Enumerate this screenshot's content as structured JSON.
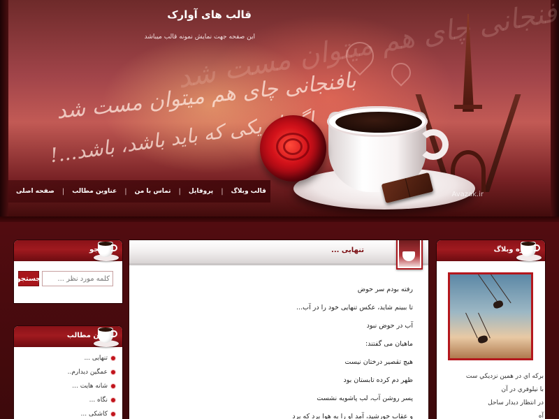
{
  "header": {
    "title": "قالب های آوارک",
    "subtitle": "این صفحه جهت نمایش نمونه قالب میباشد",
    "calligraphy_line_1": "بافنجانی چای هم میتوان مست شد",
    "calligraphy_line_2": "اگر او یکی که باید باشد، باشد...!",
    "watermark": "Avazak.ir"
  },
  "nav": {
    "items": [
      "صفحه اصلی",
      "عناوین مطالب",
      "تماس با من",
      "پروفایل",
      "قالب وبلاگ"
    ],
    "separator": "|"
  },
  "sidebar_left": {
    "search": {
      "title": "جستجو",
      "placeholder": "کلمه مورد نظر ...",
      "button_label": "جستجو"
    },
    "recent_posts": {
      "title": "اخرین مطالب",
      "items": [
        "تنهایی ...",
        "عمگین دیدارم..",
        "شانه هایت ...",
        "نگاه ...",
        "کاشکی ..."
      ]
    }
  },
  "post": {
    "title": "تنهایی ...",
    "lines": [
      "رفته بودم سر حوض",
      "تا ببینم شاید، عکس تنهایی خود را در آب...",
      "آب در حوض نبود",
      "ماهیان می گفتند:",
      "هیچ تقصیر درختان نیست",
      "ظهر دم کرده تابستان بود",
      "پسر روشن آب، لب پاشویه نشست",
      "و عقاب خورشید، آمد او را به هوا برد که برد"
    ]
  },
  "sidebar_right": {
    "about": {
      "title": "درباره وبلاگ",
      "lines": [
        "برکه اي در همين نزديکي ست",
        "با نيلوفري در آن",
        "در انتظار ديدار ساحل",
        "آه"
      ]
    }
  },
  "colors": {
    "brand_red": "#a8151b",
    "dark_maroon": "#3d090b",
    "header_pink": "#c25a55"
  }
}
